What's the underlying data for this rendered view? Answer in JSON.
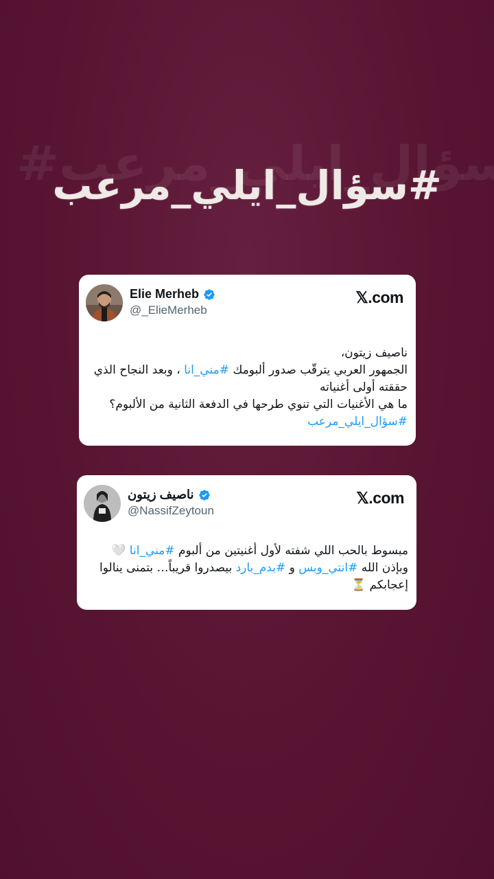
{
  "headline": "#سؤال_ايلي_مرعب",
  "colors": {
    "background": "#5a1633",
    "card": "#ffffff",
    "link": "#1d9bf0",
    "verified": "#1d9bf0",
    "handle": "#536471"
  },
  "tweets": [
    {
      "author": "Elie Merheb",
      "handle": "@_ElieMerheb",
      "site": "𝕏.com",
      "verified_icon": "verified-badge-icon",
      "lines": {
        "l1": "ناصيف زيتون،",
        "l2a": "الجمهور العربي يترقّب صدور ألبومك ",
        "l2tag": "#مني_انا",
        "l2b": " ، وبعد النجاح الذي حققته أولى أغنياته",
        "l3": "ما هي الأغنيات التي تنوي طرحها في الدفعة الثانية من الألبوم؟ ",
        "l3tag": "#سؤال_ايلي_مرعب"
      }
    },
    {
      "author": "ناصيف زيتون",
      "handle": "@NassifZeytoun",
      "site": "𝕏.com",
      "verified_icon": "verified-badge-icon",
      "lines": {
        "a": "مبسوط بالحب اللي شفته لأول أغنيتين من ألبوم ",
        "tag1": "#مني_انا",
        "heart": " 🤍",
        "b": " وبإذن الله ",
        "tag2": "#انتي_وبس",
        "c": " و ",
        "tag3": "#بدم_بارد",
        "d": " بيصدروا قريباً… بتمنى ينالوا إعجابكم ",
        "hourglass": "⏳"
      }
    }
  ]
}
